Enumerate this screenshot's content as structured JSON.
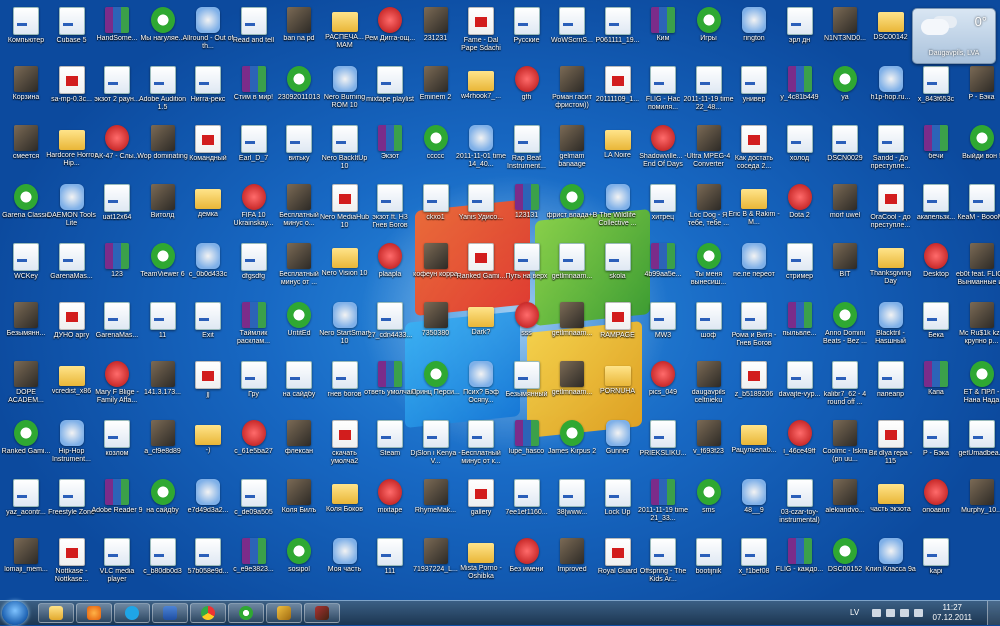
{
  "desktop": {
    "columns": [
      [
        "Компьютер",
        "Корзина",
        "смеется",
        "Garena Classic",
        "WCKey",
        "Безымянн...",
        "DOPE ACADEM...",
        "Ranked Gami...",
        "yaz_acontr...",
        "lomaji_mem..."
      ],
      [
        "Cubase 5",
        "sa-mp-0.3c...",
        "Hardcore Horror Hip...",
        "DAEMON Tools Lite",
        "GarenaMas...",
        "ДУНО аргу",
        "vcredist_x86",
        "Hip-Hop Instrument...",
        "Freestyle Zone",
        "Nottkase - Nottkase..."
      ],
      [
        "HandSome...",
        "экзот 2 раун...",
        "АК-47 - Слы...",
        "uat12x64",
        "123",
        "GarenaMas...",
        "Mary F Blige - Family Affa...",
        "козлом",
        "Adobe Reader 9",
        "VLC media player"
      ],
      [
        "Мы нагуляе...",
        "Adobe Audition 1.5",
        "Wop dominating",
        "Витолд",
        "TeamViewer 6",
        "11",
        "141.3.173...",
        "a_cf9e8d89",
        "на сайдбу",
        "c_b80db0d3"
      ],
      [
        "Allround - Out of th...",
        "Нигга-рекс",
        "Командный",
        "демка",
        "c_0b0d433c",
        "Exit",
        "jj",
        "-)",
        "e7d49d3a2...",
        "57b058e9d..."
      ],
      [
        "Read and tell",
        "Стим в мир!",
        "Earl_D_7",
        "FIFA 10 Ukrainskay...",
        "dfgsdfg",
        "Таймлик расклам...",
        "Гру",
        "c_61e5ba27",
        "c_de09a505",
        "c_e9e3823..."
      ],
      [
        "ban na pd",
        "23092011013",
        "витьку",
        "Бесплатный минус о...",
        "Бесплатный минус от ...",
        "UntitEd",
        "на сайдбу",
        "флексан",
        "Коля Билъ",
        "sosipol"
      ],
      [
        "РАСПЕЧА... МАМ",
        "Nero Burning ROM 10",
        "Nero BackItUp 10",
        "Nero MediaHub 10",
        "Nero Vision 10",
        "Nero StartSmart 10",
        "гнев богов",
        "скачать умолча2",
        "Коля Боков",
        "Моя часть"
      ],
      [
        "Рем Дигга-ощ...",
        "mixtape playlist",
        "Экзот",
        "экзот ft. Н3 Гнев Богов",
        "plaapla",
        "27_cdn4433...",
        "ответь умолчаю",
        "Steam",
        "mixtape",
        "111"
      ],
      [
        "231231",
        "Eminem 2",
        "ccccc",
        "ckxo1",
        "кофеун корра",
        "7350380",
        "Принц Перси...",
        "DjSlon i Kenya - V...",
        "RhymeMak...",
        "71937224_L..."
      ],
      [
        "Fame - Dal Pape Sdachi",
        "w4rhook7_...",
        "2011-11-01 time 14_40...",
        "Yanis Удисо...",
        "Ranked Gami...",
        "Dark?",
        "Псих? Бэф Осяпу...",
        "Бесплатный минус от к...",
        "gallery",
        "Mista Porno - Oshibka"
      ],
      [
        "Русские",
        "gfh",
        "Rap Beat Instrument...",
        "123131",
        "Путь на верх",
        "sss",
        "Безымянный",
        "lupe_fiasco",
        "7ee1ef1160...",
        "Без имени"
      ],
      [
        "WoWScrnS...",
        "Роман гасит фристом))",
        "gelmam banaage",
        "фрист влада+В",
        "getlmnaam...",
        "getlmnaam...",
        "getlmnaam...",
        "James Kirpus 2",
        "38[www...",
        "Improved"
      ],
      [
        "P061111_19...",
        "20111109_1...",
        "LA Noire",
        "The Wildlife Collective ...",
        "skola",
        "RAMPAGE",
        "PORNUHA",
        "Gunner",
        "Lock Up",
        "Royal Guard"
      ],
      [
        "Ким",
        "FLIG - Нас помиля...",
        "Shadowville... - End Of Days",
        "хитрец",
        "4b99aa5e...",
        "MW3",
        "pics_049",
        "PRIEKSLIKU...",
        "2011-11-19 time 21_33...",
        "Offspring - The Kids Ar..."
      ],
      [
        "Игры",
        "2011-11-19 time 22_48...",
        "Ultra MPEG-4 Converter",
        "Loc Dog - Я тебе, тебе ...",
        "Ты меня вынесиш...",
        "шоф",
        "daugavpils celtnieku",
        "v_f693f23",
        "sms",
        "bootijnik"
      ],
      [
        "rington",
        "универ",
        "Как достать соседа 2...",
        "Eric B & Rakim - M...",
        "пе.пе переот",
        "Рома и Витя - Гнев Богов",
        "z_b5189206",
        "Рацульелаб...",
        "48__9",
        "x_f1bef08"
      ],
      [
        "эрл дн",
        "y_4c81b449",
        "холод",
        "Dota 2",
        "стример",
        "пыльвле...",
        "davajte-vyp...",
        "i_46ce49ff",
        "03-czar-toy-instrumental)",
        "FLIG - каждо..."
      ],
      [
        "N1NT3ND0...",
        "ya",
        "DSCN0029",
        "morf uwel",
        "BIT",
        "Anno Domini Beats - Bez ...",
        "kalibr7_62 - 4 round off ...",
        "Coolmc - Iskra (pn uu...",
        "alekiandvo...",
        "DSC00152"
      ],
      [
        "DSC00142",
        "h1p-hop.ru...",
        "Sandd - До преступле...",
        "OraCool - до преступле...",
        "Thanksgiving Day",
        "Blacktril - Наsшный",
        "папеапр",
        "Bit dlya repa - 115",
        "часть экзота",
        "Клип Класса 9а"
      ],
      [
        "",
        "x_843f653c",
        "бечи",
        "акапельзк...",
        "Desktop",
        "Бека",
        "Капа",
        "P - Бэка",
        "oпоавлл",
        "kapi"
      ],
      [
        "",
        "P - Бэка",
        "Выйди вон !",
        "КеаМ - BoooM!",
        "eb0t feat. FLIG - Вынманные из ряд",
        "Mc Ru$1k kz - крупно р...",
        "ET & ПРЛ - Нана Нада",
        "getUmadbea...",
        "Murphy_10...",
        ""
      ]
    ]
  },
  "weather": {
    "temp": "0°",
    "location": "Daugavpils, LVA"
  },
  "taskbar": {
    "language": "LV",
    "time": "11:27",
    "date": "07.12.2011"
  }
}
